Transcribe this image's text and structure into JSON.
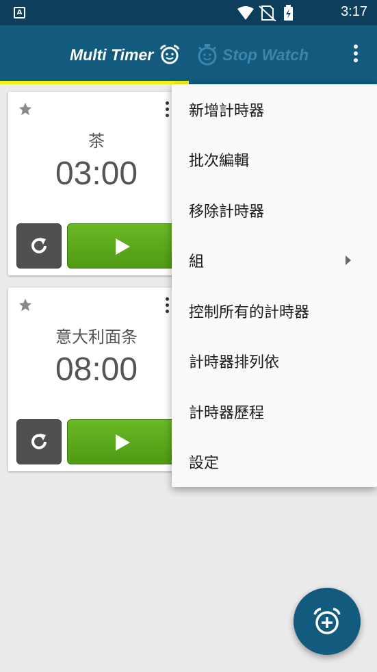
{
  "status_bar": {
    "time": "3:17",
    "app_icon_letter": "A",
    "icons": [
      "notification-a-icon",
      "wifi-icon",
      "no-sim-icon",
      "battery-charging-icon"
    ]
  },
  "app_bar": {
    "tabs": [
      {
        "label": "Multi Timer",
        "icon": "alarm-face-icon",
        "active": true
      },
      {
        "label": "Stop Watch",
        "icon": "stopwatch-icon",
        "active": false
      }
    ],
    "indicator_color": "#f2f219",
    "overflow_icon": "more-vert-icon"
  },
  "timers": [
    {
      "name": "茶",
      "time": "03:00",
      "starred": false
    },
    {
      "name": "意大利面条",
      "time": "08:00",
      "starred": false
    }
  ],
  "menu": {
    "items": [
      {
        "label": "新增計時器"
      },
      {
        "label": "批次編輯"
      },
      {
        "label": "移除計時器"
      },
      {
        "label": "組",
        "has_submenu": true
      },
      {
        "label": "控制所有的計時器"
      },
      {
        "label": "計時器排列依"
      },
      {
        "label": "計時器歷程"
      },
      {
        "label": "設定"
      }
    ]
  },
  "fab": {
    "icon": "add-alarm-icon"
  },
  "colors": {
    "status_bar": "#0d3f5c",
    "app_bar": "#125a7e",
    "play_button": "#5aa81c",
    "reset_button": "#505050",
    "background": "#ebebeb"
  }
}
